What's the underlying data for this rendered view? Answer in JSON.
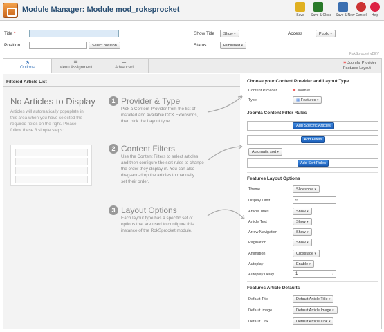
{
  "header": {
    "title": "Module Manager: Module mod_roksprocket",
    "toolbar": [
      {
        "label": "Save",
        "color": "#e0b020",
        "icon": "save-icon"
      },
      {
        "label": "Save & Close",
        "color": "#2a7a2a",
        "icon": "save-close-icon"
      },
      {
        "label": "Save & New",
        "color": "#3b6fb0",
        "icon": "save-new-icon"
      },
      {
        "label": "Cancel",
        "color": "#c33",
        "icon": "cancel-icon"
      },
      {
        "label": "Help",
        "color": "#d24",
        "icon": "help-icon"
      }
    ]
  },
  "form": {
    "title_label": "Title",
    "position_label": "Position",
    "select_position": "Select position",
    "show_title_label": "Show Title",
    "show_title_value": "Show",
    "access_label": "Access",
    "access_value": "Public",
    "status_label": "Status",
    "status_value": "Published"
  },
  "brand": "RokSprocket vDEV",
  "tabs": [
    "Options",
    "Menu Assignment",
    "Advanced"
  ],
  "provider_badge": {
    "line1": "Joomla! Provider",
    "line2": "Features Layout"
  },
  "left": {
    "section": "Filtered Article List",
    "title": "No Articles to Display",
    "desc": [
      "Articles will automatically popuplate in",
      "this area when you have selected the",
      "required fields on the right. Please",
      "follow these 3 simple steps:"
    ],
    "steps": [
      {
        "num": "1",
        "title": "Provider & Type",
        "text": [
          "Pick a Content Provider from the list of",
          "installed and available CCK Extensions,",
          "then pick the Layout type."
        ]
      },
      {
        "num": "2",
        "title": "Content Filters",
        "text": [
          "Use the Content Filters to select articles",
          "and then configure the sort rules to change",
          "the order they display in.  You can also",
          "drag-and-drop the articles to manually",
          "set their order."
        ]
      },
      {
        "num": "3",
        "title": "Layout Options",
        "text": [
          "Each layout type has a specific set of",
          "options that are used to configure this",
          "instance of the RokSprocket module."
        ]
      }
    ]
  },
  "right": {
    "provider_title": "Choose your Content Provider and Layout Type",
    "content_provider_label": "Content Provider",
    "content_provider_value": "Joomla!",
    "type_label": "Type",
    "type_value": "Features",
    "filter_title": "Joomla Content Filter Rules",
    "add_specific": "Add Specific Articles",
    "add_filters": "Add Filters",
    "automatic_sort": "Automatic sort",
    "add_sort": "Add Sort Rules",
    "layout_title": "Features Layout Options",
    "layout_options": [
      {
        "label": "Theme",
        "value": "Slideshow",
        "kind": "dd"
      },
      {
        "label": "Display Limit",
        "value": "∞",
        "kind": "input"
      },
      {
        "label": "Article Titles",
        "value": "Show",
        "kind": "dd"
      },
      {
        "label": "Article Text",
        "value": "Show",
        "kind": "dd"
      },
      {
        "label": "Arrow Navigation",
        "value": "Show",
        "kind": "dd"
      },
      {
        "label": "Pagination",
        "value": "Show",
        "kind": "dd"
      },
      {
        "label": "Animation",
        "value": "Crossfade",
        "kind": "dd"
      },
      {
        "label": "Autoplay",
        "value": "Enable",
        "kind": "dd"
      },
      {
        "label": "Autoplay Delay",
        "value": "1",
        "kind": "stepper"
      }
    ],
    "defaults_title": "Features Article Defaults",
    "defaults": [
      {
        "label": "Default Title",
        "value": "Default Article Title"
      },
      {
        "label": "Default Image",
        "value": "Default Article Image"
      },
      {
        "label": "Default Link",
        "value": "Default Article Link"
      }
    ]
  }
}
